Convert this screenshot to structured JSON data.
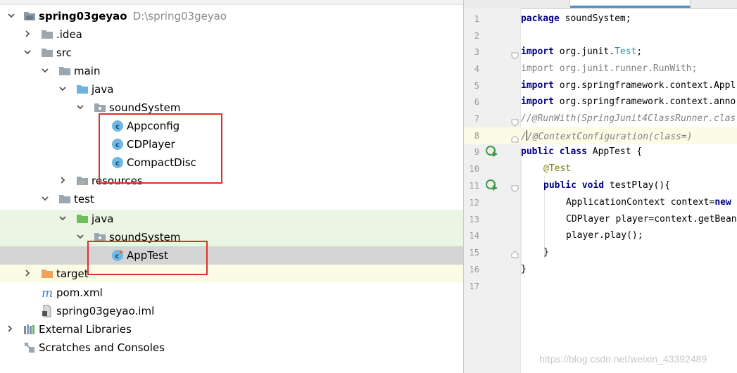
{
  "project_tree": {
    "root": {
      "name": "spring03geyao",
      "path": "D:\\spring03geyao"
    },
    "items": [
      {
        "label": ".idea"
      },
      {
        "label": "src"
      },
      {
        "label": "main"
      },
      {
        "label": "java"
      },
      {
        "label": "soundSystem"
      },
      {
        "label": "Appconfig"
      },
      {
        "label": "CDPlayer"
      },
      {
        "label": "CompactDisc"
      },
      {
        "label": "resources"
      },
      {
        "label": "test"
      },
      {
        "label": "java"
      },
      {
        "label": "soundSystem"
      },
      {
        "label": "AppTest"
      },
      {
        "label": "target"
      },
      {
        "label": "pom.xml"
      },
      {
        "label": "spring03geyao.iml"
      },
      {
        "label": "External Libraries"
      },
      {
        "label": "Scratches and Consoles"
      }
    ]
  },
  "editor": {
    "line_numbers": [
      "1",
      "2",
      "3",
      "4",
      "5",
      "6",
      "7",
      "8",
      "9",
      "10",
      "11",
      "12",
      "13",
      "14",
      "15",
      "16",
      "17"
    ],
    "tokens": {
      "package": "package",
      "pkg_name": " soundSystem;",
      "import": "import",
      "imp1_a": " org.junit.",
      "imp1_b": "Test",
      "imp1_c": ";",
      "imp2": " org.junit.runner.RunWith;",
      "imp3": " org.springframework.context.Appl",
      "imp4": " org.springframework.context.anno",
      "comment7": "//@RunWith(SpringJunit4ClassRunner.clas",
      "comment8_a": "/",
      "comment8_b": "/@ContextConfiguration(class=)",
      "public": "public",
      "class": "class",
      "class_name": " AppTest {",
      "annotation": "@Test",
      "void": "void",
      "method": " testPlay(){",
      "l12_a": "ApplicationContext context=",
      "new": "new",
      "l13": "CDPlayer player=context.getBean",
      "l14": "player.play();",
      "close_inner": "}",
      "close_outer": "}"
    }
  },
  "watermark": "https://blog.csdn.net/weixin_43392489",
  "colors": {
    "keyword": "#000080",
    "comment": "#808080",
    "annotation": "#808000",
    "test_source_highlight": "#eaf5e3",
    "selection": "#d4d4d4",
    "red_box": "#e0302c"
  },
  "icons": {
    "folder": "folder-icon",
    "source_folder": "source-folder-icon",
    "test_source_folder": "test-source-folder-icon",
    "package": "package-icon",
    "class": "class-icon",
    "test_class": "test-class-icon",
    "excluded_folder": "excluded-folder-icon",
    "maven": "maven-icon",
    "iml": "iml-file-icon",
    "libraries": "libraries-icon",
    "scratches": "scratches-icon",
    "run_gutter": "run-test-icon"
  }
}
